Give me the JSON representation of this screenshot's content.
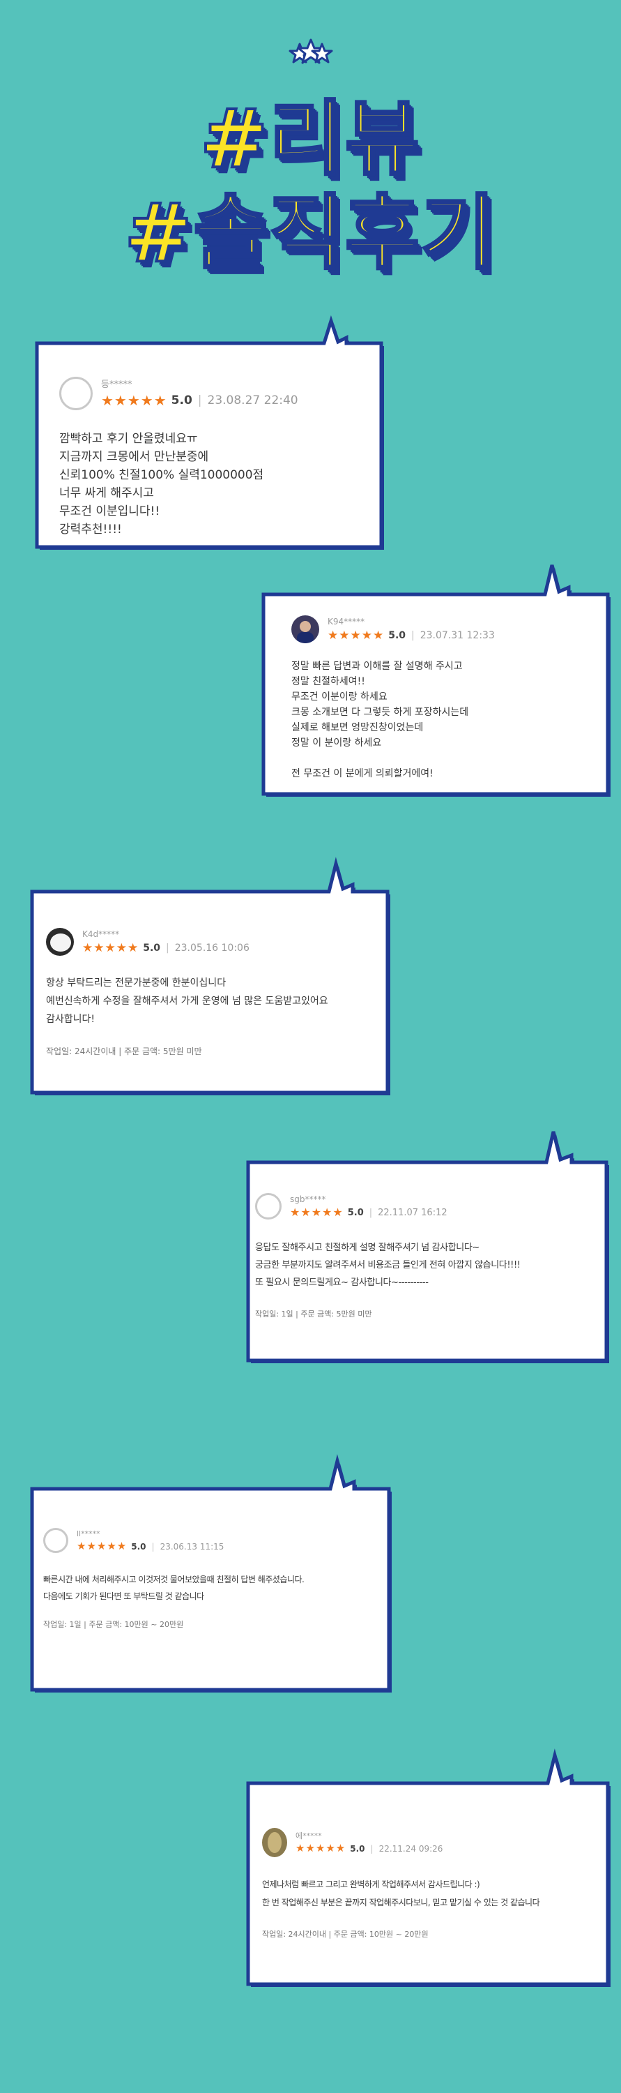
{
  "header": {
    "line1": "#리뷰",
    "line2": "#솔직후기"
  },
  "reviews": [
    {
      "name": "등*****",
      "stars": "★★★★★",
      "score": "5.0",
      "date": "23.08.27 22:40",
      "lines": [
        "깜빡하고 후기 안올렸네요ㅠ",
        "지금까지 크몽에서 만난분중에",
        "신뢰100% 친절100% 실력1000000점",
        "너무 싸게 해주시고",
        "무조건 이분입니다!!",
        "강력추천!!!!"
      ],
      "footer": ""
    },
    {
      "name": "K94*****",
      "stars": "★★★★★",
      "score": "5.0",
      "date": "23.07.31 12:33",
      "lines": [
        "정말 빠른 답변과 이해를 잘 설명해 주시고",
        "정말 친절하세여!!",
        "무조건 이분이랑 하세요",
        "크몽 소개보면 다 그렇듯 하게 포장하시는데",
        "실제로 해보면 엉망진창이었는데",
        "정말 이 분이랑 하세요",
        "",
        "전 무조건 이 분에게 의뢰할거에여!"
      ],
      "footer": ""
    },
    {
      "name": "K4d*****",
      "stars": "★★★★★",
      "score": "5.0",
      "date": "23.05.16 10:06",
      "lines": [
        "항상 부탁드리는 전문가분중에 한분이십니다",
        "예번신속하게 수정을 잘해주셔서 가게 운영에 넘 많은 도움받고있어요",
        "감사합니다!"
      ],
      "footer": "작업일: 24시간이내 | 주문 금액: 5만원 미만"
    },
    {
      "name": "sgb*****",
      "stars": "★★★★★",
      "score": "5.0",
      "date": "22.11.07 16:12",
      "lines": [
        "응답도 잘해주시고 친절하게 설명 잘해주셔기 넘 감사합니다~",
        "궁금한 부분까지도 알려주셔서 비용조금 들인게 전혀 아깝지 않습니다!!!!",
        "또 필요시 문의드릴게요~ 감사합니다~----------"
      ],
      "footer": "작업일: 1일 | 주문 금액: 5만원 미만"
    },
    {
      "name": "ll*****",
      "stars": "★★★★★",
      "score": "5.0",
      "date": "23.06.13 11:15",
      "lines": [
        "빠른시간 내에 처리해주시고 이것저것 물어보았을때 친절히 답변 해주셨습니다.",
        "다음에도 기회가 된다면 또 부탁드릴 것 같습니다"
      ],
      "footer": "작업일: 1일 | 주문 금액: 10만원 ~ 20만원"
    },
    {
      "name": "에*****",
      "stars": "★★★★★",
      "score": "5.0",
      "date": "22.11.24 09:26",
      "lines": [
        "언제나처럼 빠르고 그리고 완벽하게 작업해주셔서 감사드립니다 :)",
        "한 번 작업해주신 부분은 끝까지 작업해주시다보니, 믿고 맡기실 수 있는 것 같습니다"
      ],
      "footer": "작업일: 24시간이내 | 주문 금액: 10만원 ~ 20만원"
    }
  ]
}
